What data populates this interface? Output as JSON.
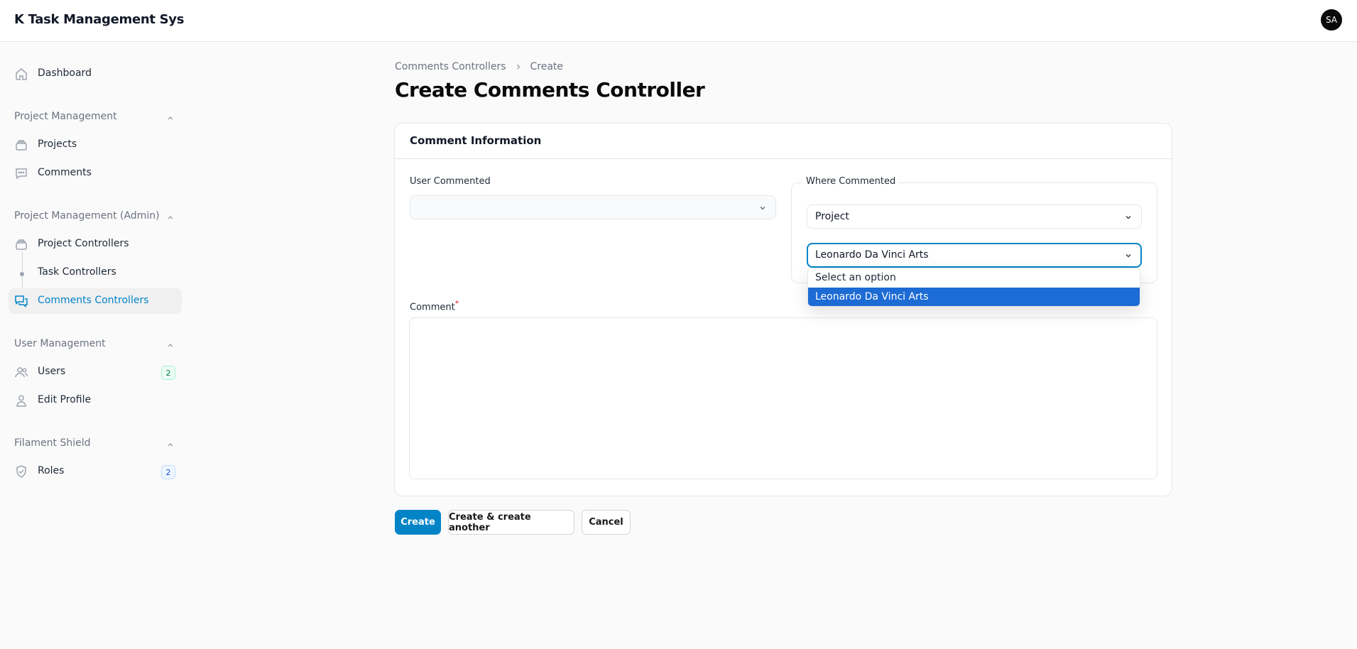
{
  "app": {
    "brand": "K Task Management Sys",
    "avatar_initials": "SA"
  },
  "sidebar": {
    "dashboard": "Dashboard",
    "groups": [
      {
        "title": "Project Management",
        "items": [
          "Projects",
          "Comments"
        ]
      },
      {
        "title": "Project Management (Admin)",
        "items": [
          "Project Controllers",
          "Task Controllers",
          "Comments Controllers"
        ]
      },
      {
        "title": "User Management",
        "items": [
          "Users",
          "Edit Profile"
        ]
      },
      {
        "title": "Filament Shield",
        "items": [
          "Roles"
        ]
      }
    ],
    "active_item": "Comments Controllers",
    "users_badge": "2",
    "roles_badge": "2"
  },
  "breadcrumb": {
    "parent": "Comments Controllers",
    "current": "Create"
  },
  "page_title": "Create Comments Controller",
  "form": {
    "section_title": "Comment Information",
    "user_commented": {
      "label": "User Commented",
      "value": ""
    },
    "where_commented": {
      "legend": "Where Commented",
      "type_value": "Project",
      "target_value": "Leonardo Da Vinci Arts",
      "options": [
        "Select an option",
        "Leonardo Da Vinci Arts"
      ],
      "highlighted_option": "Leonardo Da Vinci Arts"
    },
    "comment": {
      "label": "Comment",
      "required_marker": "*",
      "value": ""
    }
  },
  "actions": {
    "create": "Create",
    "create_another": "Create & create another",
    "cancel": "Cancel"
  },
  "colors": {
    "primary": "#0284c7",
    "highlight": "#1d6bd4",
    "required": "#dc2626"
  }
}
